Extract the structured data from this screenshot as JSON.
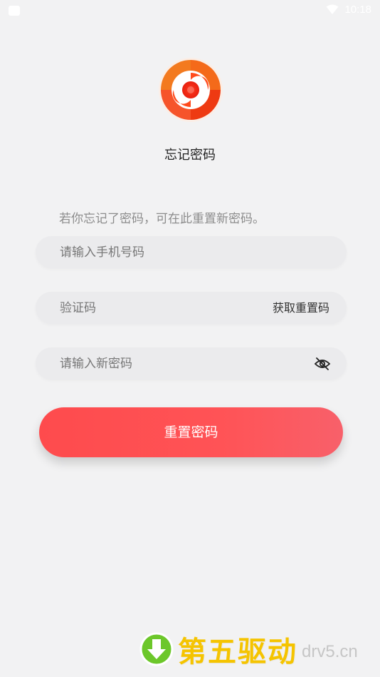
{
  "status_bar": {
    "time": "10:18"
  },
  "page": {
    "title": "忘记密码",
    "hint": "若你忘记了密码，可在此重置新密码。"
  },
  "form": {
    "phone_placeholder": "请输入手机号码",
    "code_placeholder": "验证码",
    "get_code_label": "获取重置码",
    "password_placeholder": "请输入新密码",
    "submit_label": "重置密码"
  },
  "watermark": {
    "text": "第五驱动",
    "domain": "drv5.cn"
  },
  "colors": {
    "accent": "#fe4b4d",
    "background": "#f2f2f3",
    "field": "#ebebed",
    "watermark": "#f5c400"
  },
  "icons": {
    "app_logo": "swirl-logo-icon",
    "password_visibility": "eye-off-icon",
    "status_wifi": "wifi-icon",
    "watermark_arrow": "download-arrow-icon"
  }
}
